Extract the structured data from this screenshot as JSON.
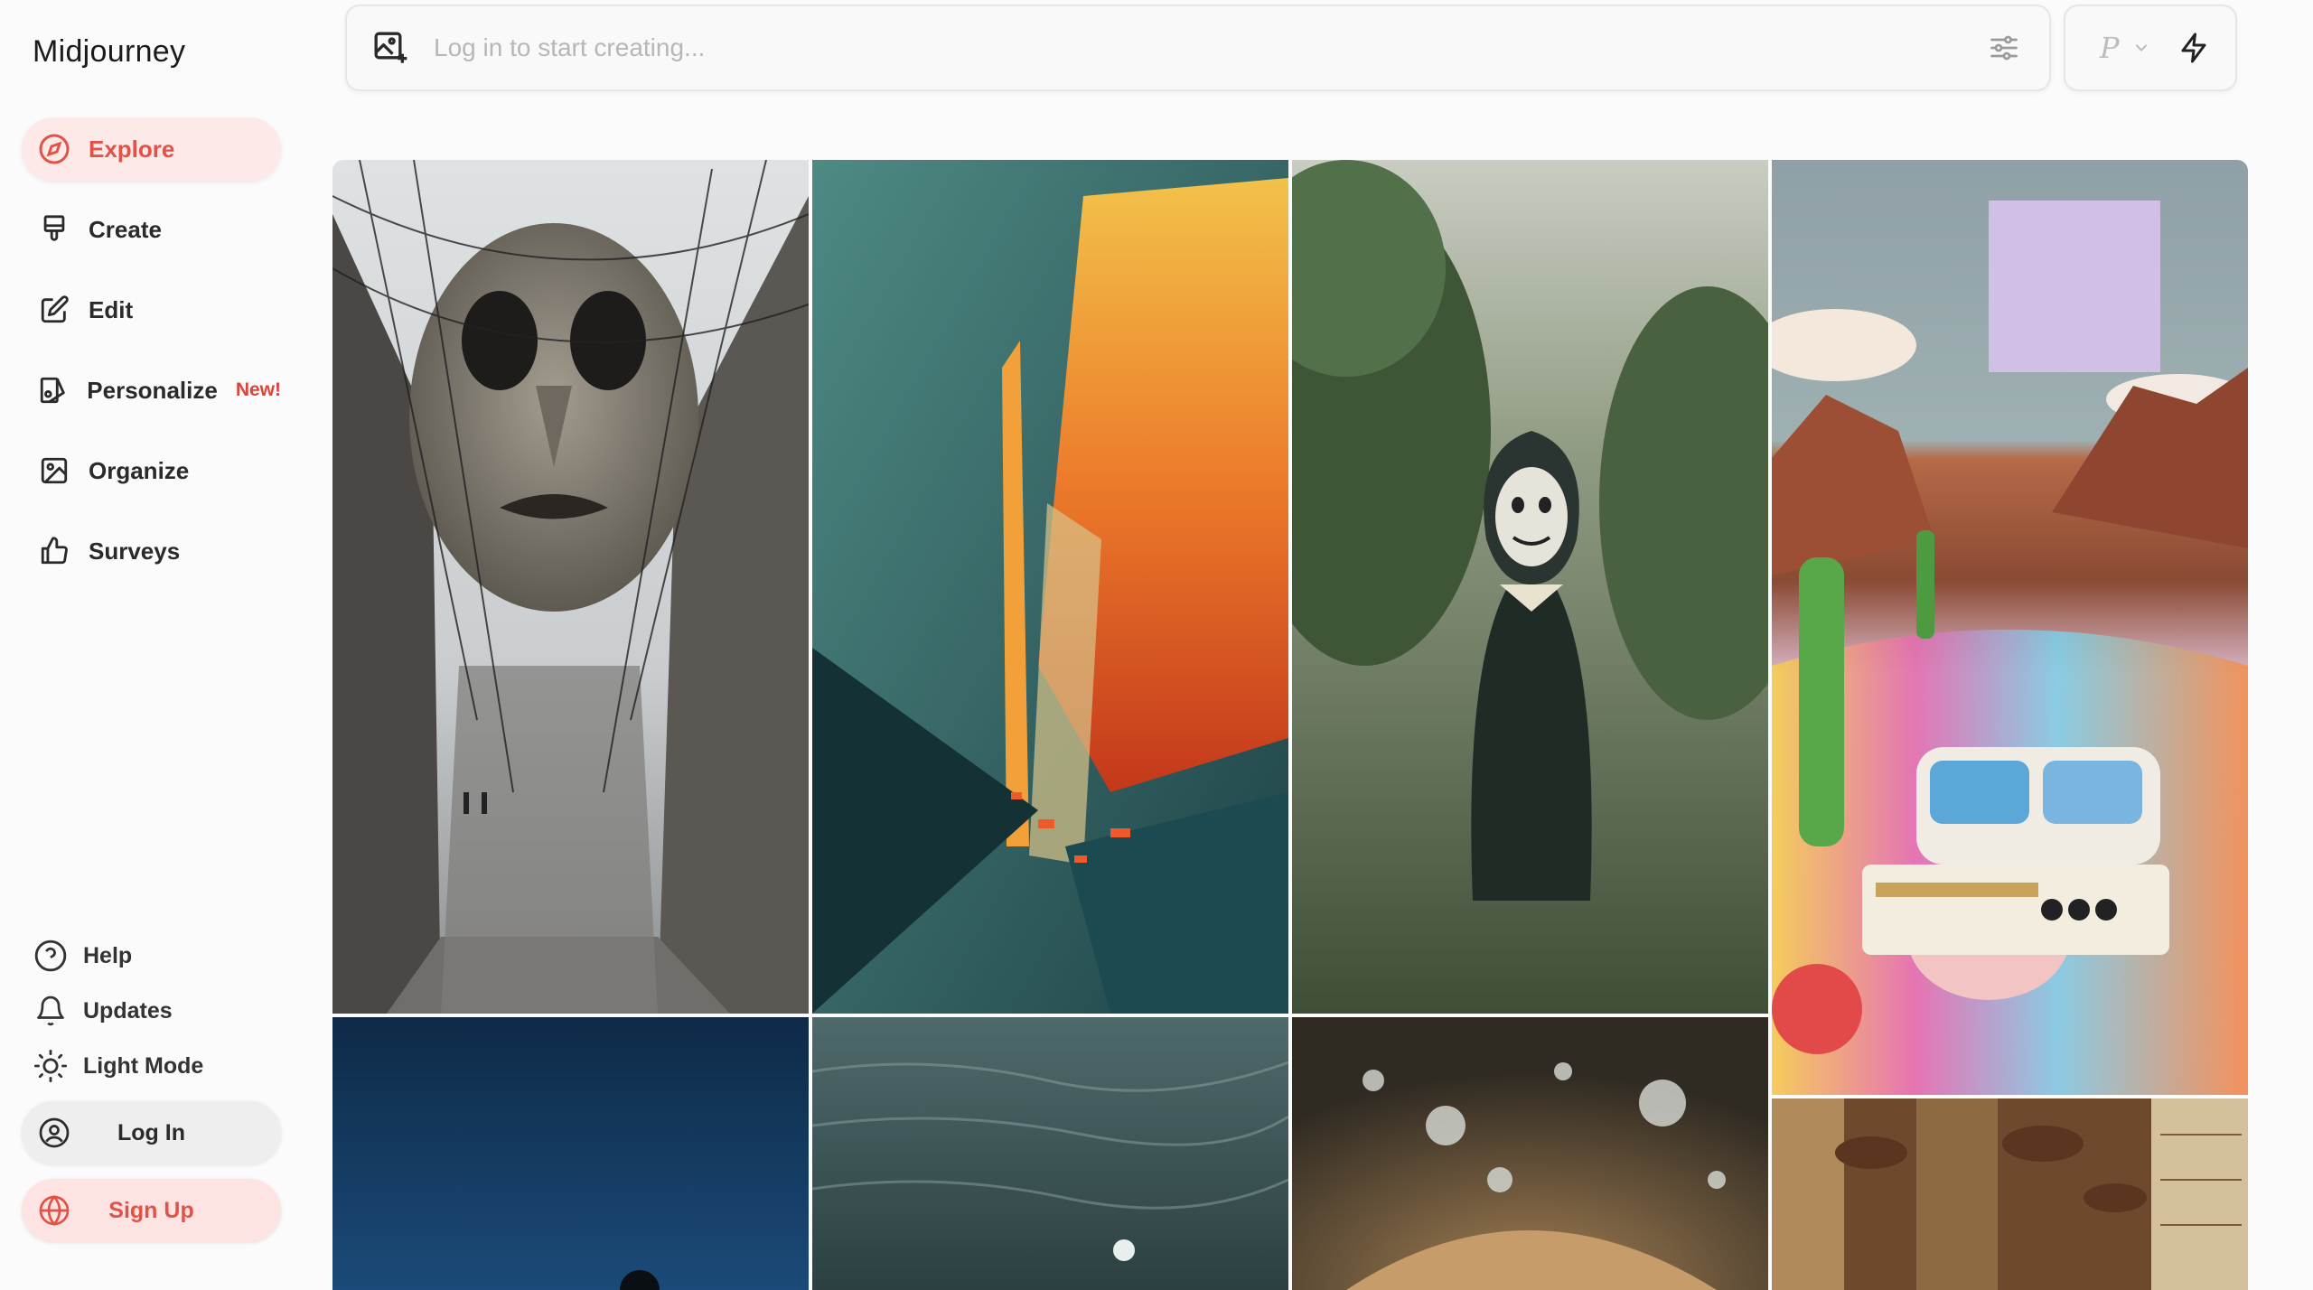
{
  "app": {
    "brand": "Midjourney"
  },
  "nav": {
    "items": [
      {
        "label": "Explore",
        "icon": "compass-icon",
        "active": true
      },
      {
        "label": "Create",
        "icon": "paintbrush-icon"
      },
      {
        "label": "Edit",
        "icon": "edit-icon"
      },
      {
        "label": "Personalize",
        "icon": "personalize-icon",
        "badge": "New!"
      },
      {
        "label": "Organize",
        "icon": "image-icon"
      },
      {
        "label": "Surveys",
        "icon": "thumbs-up-icon"
      }
    ]
  },
  "footer": {
    "help": "Help",
    "updates": "Updates",
    "light_mode": "Light Mode",
    "login": "Log In",
    "signup": "Sign Up"
  },
  "prompt": {
    "placeholder": "Log in to start creating..."
  },
  "mode": {
    "label": "P"
  },
  "colors": {
    "accent": "#e25247",
    "active_bg": "#fde9e8",
    "badge": "#e0423a"
  },
  "gallery": {
    "tiles": [
      {
        "name": "gallery-image-giant-mask-street",
        "col": 1,
        "row": 1
      },
      {
        "name": "gallery-image-abstract-color-burst",
        "col": 2,
        "row": 1
      },
      {
        "name": "gallery-image-masked-child-orchard",
        "col": 3,
        "row": 1
      },
      {
        "name": "gallery-image-retro-desert-collage",
        "col": 4,
        "row": 1
      },
      {
        "name": "gallery-image-blue-sky-figure",
        "col": 1,
        "row": 2
      },
      {
        "name": "gallery-image-water-surface",
        "col": 2,
        "row": 2
      },
      {
        "name": "gallery-image-water-droplets",
        "col": 3,
        "row": 2
      },
      {
        "name": "gallery-image-egyptian-temple",
        "col": 4,
        "row": 2
      }
    ]
  }
}
